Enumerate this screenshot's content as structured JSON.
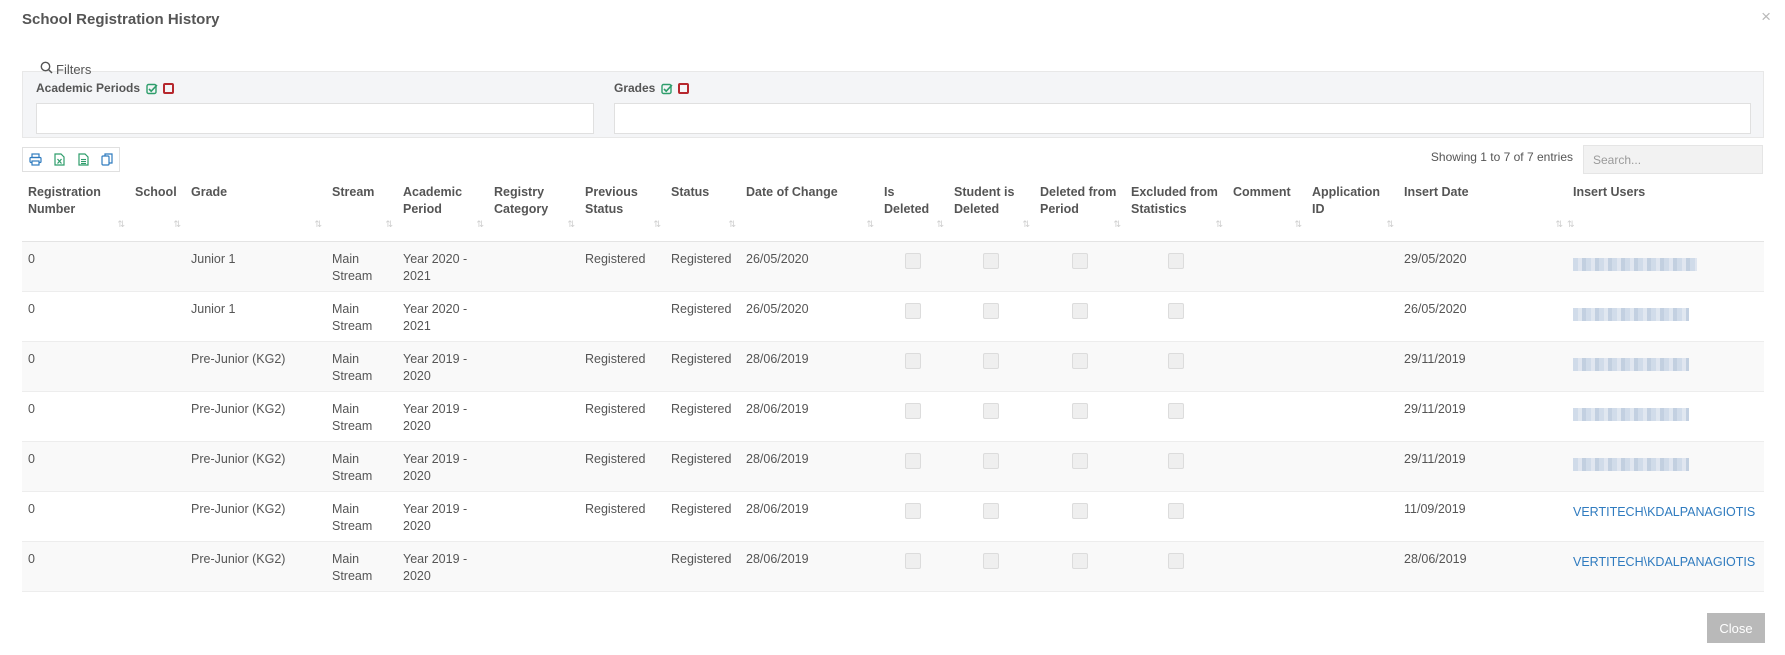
{
  "modal": {
    "title": "School Registration History",
    "close_label": "Close"
  },
  "filters": {
    "label": "Filters",
    "academic_periods_label": "Academic Periods",
    "grades_label": "Grades"
  },
  "table_info": {
    "showing": "Showing 1 to 7 of 7 entries",
    "search_placeholder": "Search..."
  },
  "columns": [
    "Registration Number",
    "School",
    "Grade",
    "Stream",
    "Academic Period",
    "Registry Category",
    "Previous Status",
    "Status",
    "Date of Change",
    "Is Deleted",
    "Student is Deleted",
    "Deleted from Period",
    "Excluded from Statistics",
    "Comment",
    "Application ID",
    "Insert Date",
    "Insert Users"
  ],
  "rows": [
    {
      "reg_no": "0",
      "school": "",
      "grade": "Junior 1",
      "stream": "Main Stream",
      "period": "Year 2020 - 2021",
      "category": "",
      "prev_status": "Registered",
      "status": "Registered",
      "date_change": "26/05/2020",
      "comment": "",
      "app_id": "",
      "insert_date": "29/05/2020",
      "insert_user": ""
    },
    {
      "reg_no": "0",
      "school": "",
      "grade": "Junior 1",
      "stream": "Main Stream",
      "period": "Year 2020 - 2021",
      "category": "",
      "prev_status": "",
      "status": "Registered",
      "date_change": "26/05/2020",
      "comment": "",
      "app_id": "",
      "insert_date": "26/05/2020",
      "insert_user": ""
    },
    {
      "reg_no": "0",
      "school": "",
      "grade": "Pre-Junior (KG2)",
      "stream": "Main Stream",
      "period": "Year 2019 - 2020",
      "category": "",
      "prev_status": "Registered",
      "status": "Registered",
      "date_change": "28/06/2019",
      "comment": "",
      "app_id": "",
      "insert_date": "29/11/2019",
      "insert_user": ""
    },
    {
      "reg_no": "0",
      "school": "",
      "grade": "Pre-Junior (KG2)",
      "stream": "Main Stream",
      "period": "Year 2019 - 2020",
      "category": "",
      "prev_status": "Registered",
      "status": "Registered",
      "date_change": "28/06/2019",
      "comment": "",
      "app_id": "",
      "insert_date": "29/11/2019",
      "insert_user": ""
    },
    {
      "reg_no": "0",
      "school": "",
      "grade": "Pre-Junior (KG2)",
      "stream": "Main Stream",
      "period": "Year 2019 - 2020",
      "category": "",
      "prev_status": "Registered",
      "status": "Registered",
      "date_change": "28/06/2019",
      "comment": "",
      "app_id": "",
      "insert_date": "29/11/2019",
      "insert_user": ""
    },
    {
      "reg_no": "0",
      "school": "",
      "grade": "Pre-Junior (KG2)",
      "stream": "Main Stream",
      "period": "Year 2019 - 2020",
      "category": "",
      "prev_status": "Registered",
      "status": "Registered",
      "date_change": "28/06/2019",
      "comment": "",
      "app_id": "",
      "insert_date": "11/09/2019",
      "insert_user": "VERTITECH\\KDALPANAGIOTIS"
    },
    {
      "reg_no": "0",
      "school": "",
      "grade": "Pre-Junior (KG2)",
      "stream": "Main Stream",
      "period": "Year 2019 - 2020",
      "category": "",
      "prev_status": "",
      "status": "Registered",
      "date_change": "28/06/2019",
      "comment": "",
      "app_id": "",
      "insert_date": "28/06/2019",
      "insert_user": "VERTITECH\\KDALPANAGIOTIS"
    }
  ],
  "colors": {
    "link": "#2f7bbf",
    "check_all": "#2e9d6b",
    "clear_all": "#b6272d",
    "toolbar_icon": "#2f7bbf",
    "close_button": "#b9b9b9"
  }
}
